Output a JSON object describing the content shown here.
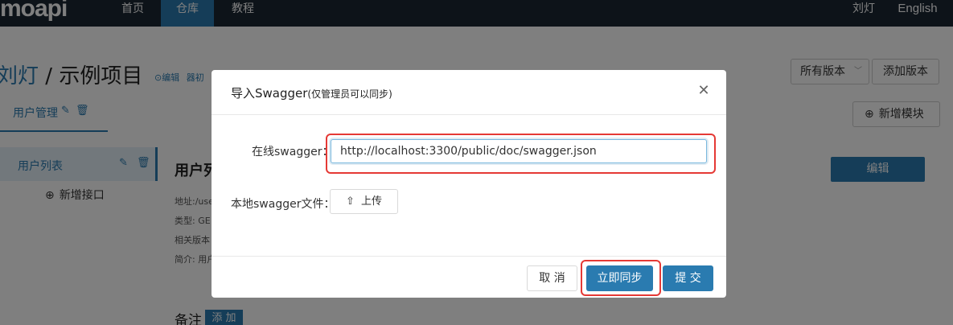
{
  "nav": {
    "logo": "moapi",
    "items": [
      "首页",
      "仓库",
      "教程"
    ],
    "user": "刘灯",
    "lang": "English"
  },
  "project": {
    "user": "刘灯",
    "sep": " / ",
    "name": "示例项目",
    "edit_link": "⊙编辑",
    "init_link": "器初"
  },
  "version": {
    "selected": "所有版本",
    "add_label": "添加版本"
  },
  "module_tab": {
    "label": "用户管理"
  },
  "add_module_label": "新增模块",
  "sidebar": {
    "item_label": "用户列表",
    "add_api_label": "新增接口"
  },
  "detail": {
    "title": "用户列",
    "lines": [
      "地址:/use",
      "类型: GE",
      "相关版本",
      "简介: 用户"
    ],
    "edit_label": "编辑"
  },
  "notes": {
    "label": "备注",
    "add_label": "添 加"
  },
  "modal": {
    "title": "导入Swagger",
    "subtitle": "(仅管理员可以同步)",
    "online_label": "在线swagger：",
    "url_value": "http://localhost:3300/public/doc/swagger.json",
    "local_label": "本地swagger文件：",
    "upload_label": "上传",
    "cancel_label": "取 消",
    "sync_label": "立即同步",
    "submit_label": "提 交"
  },
  "colors": {
    "accent": "#2a7bb0",
    "highlight": "#e53935",
    "nav_bg": "#1a2633"
  }
}
